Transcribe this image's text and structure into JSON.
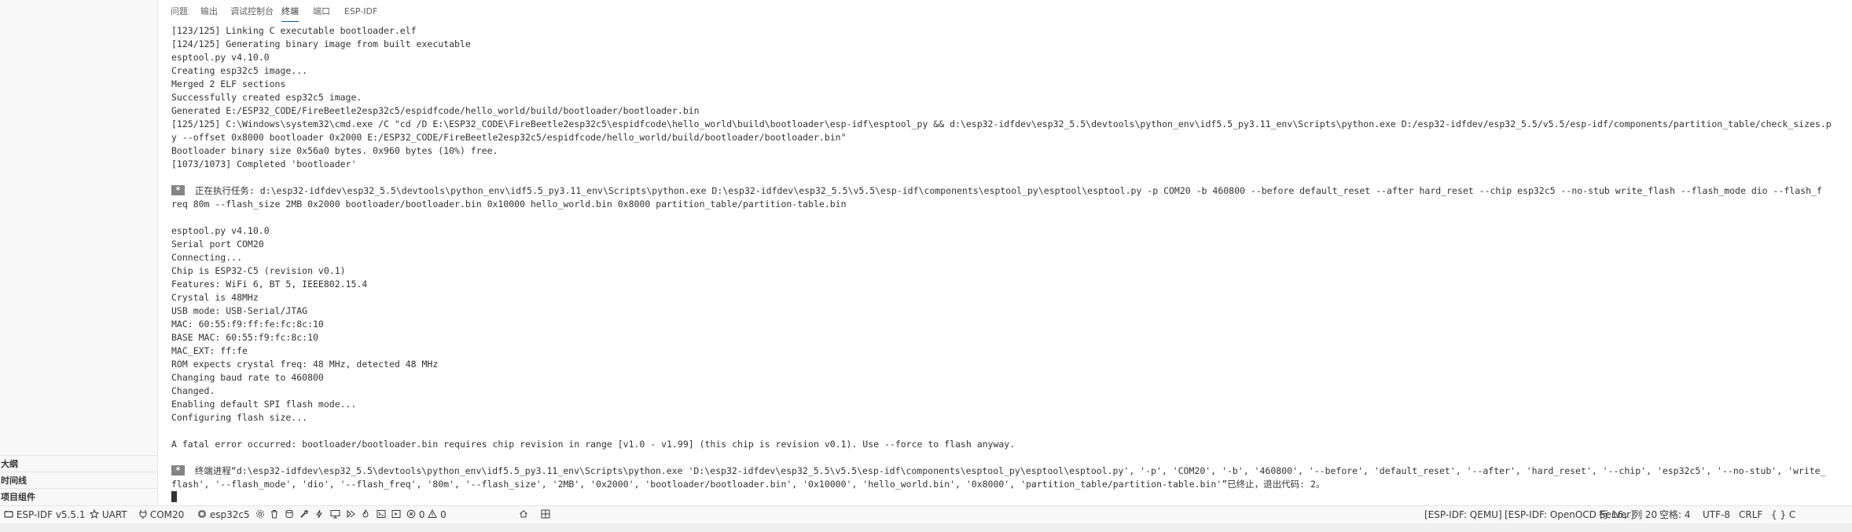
{
  "sidebar": {
    "sections": [
      "大纲",
      "时间线",
      "项目组件"
    ]
  },
  "panel": {
    "tabs": [
      "问题",
      "输出",
      "调试控制台",
      "终端",
      "端口",
      "ESP-IDF"
    ],
    "active_tab": "终端"
  },
  "terminal": {
    "lines": [
      "[123/125] Linking C executable bootloader.elf",
      "[124/125] Generating binary image from built executable",
      "esptool.py v4.10.0",
      "Creating esp32c5 image...",
      "Merged 2 ELF sections",
      "Successfully created esp32c5 image.",
      "Generated E:/ESP32_CODE/FireBeetle2esp32c5/espidfcode/hello_world/build/bootloader/bootloader.bin",
      "[125/125] C:\\Windows\\system32\\cmd.exe /C \"cd /D E:\\ESP32_CODE\\FireBeetle2esp32c5\\espidfcode\\hello_world\\build\\bootloader\\esp-idf\\esptool_py && d:\\esp32-idfdev\\esp32_5.5\\devtools\\python_env\\idf5.5_py3.11_env\\Scripts\\python.exe D:/esp32-idfdev/esp32_5.5/v5.5/esp-idf/components/partition_table/check_sizes.p",
      "y --offset 0x8000 bootloader 0x2000 E:/ESP32_CODE/FireBeetle2esp32c5/espidfcode/hello_world/build/bootloader/bootloader.bin\"",
      "Bootloader binary size 0x56a0 bytes. 0x960 bytes (10%) free.",
      "[1073/1073] Completed 'bootloader'",
      "",
      " 正在执行任务: d:\\esp32-idfdev\\esp32_5.5\\devtools\\python_env\\idf5.5_py3.11_env\\Scripts\\python.exe D:\\esp32-idfdev\\esp32_5.5\\v5.5\\esp-idf\\components\\esptool_py\\esptool\\esptool.py -p COM20 -b 460800 --before default_reset --after hard_reset --chip esp32c5 --no-stub write_flash --flash_mode dio --flash_f",
      "req 80m --flash_size 2MB 0x2000 bootloader/bootloader.bin 0x10000 hello_world.bin 0x8000 partition_table/partition-table.bin",
      "",
      "esptool.py v4.10.0",
      "Serial port COM20",
      "Connecting...",
      "Chip is ESP32-C5 (revision v0.1)",
      "Features: WiFi 6, BT 5, IEEE802.15.4",
      "Crystal is 48MHz",
      "USB mode: USB-Serial/JTAG",
      "MAC: 60:55:f9:ff:fe:fc:8c:10",
      "BASE MAC: 60:55:f9:fc:8c:10",
      "MAC_EXT: ff:fe",
      "ROM expects crystal freq: 48 MHz, detected 48 MHz",
      "Changing baud rate to 460800",
      "Changed.",
      "Enabling default SPI flash mode...",
      "Configuring flash size...",
      "",
      "A fatal error occurred: bootloader/bootloader.bin requires chip revision in range [v1.0 - v1.99] (this chip is revision v0.1). Use --force to flash anyway.",
      "",
      " 终端进程“d:\\esp32-idfdev\\esp32_5.5\\devtools\\python_env\\idf5.5_py3.11_env\\Scripts\\python.exe 'D:\\esp32-idfdev\\esp32_5.5\\v5.5\\esp-idf\\components\\esptool_py\\esptool\\esptool.py', '-p', 'COM20', '-b', '460800', '--before', 'default_reset', '--after', 'hard_reset', '--chip', 'esp32c5', '--no-stub', 'write_",
      "flash', '--flash_mode', 'dio', '--flash_freq', '80m', '--flash_size', '2MB', '0x2000', 'bootloader/bootloader.bin', '0x10000', 'hello_world.bin', '0x8000', 'partition_table/partition-table.bin'”已终止，退出代码: 2。",
      ""
    ],
    "task_star": "*"
  },
  "statusbar": {
    "idf_version": "ESP-IDF v5.5.1",
    "uart": "UART",
    "port": "COM20",
    "target": "esp32c5",
    "problems_errors": "0",
    "problems_warnings": "0",
    "qemu": "[ESP-IDF: QEMU]",
    "openocd": "[ESP-IDF: OpenOCD Server]",
    "cursor_pos": "行 16，列 20",
    "spaces": "空格: 4",
    "encoding": "UTF-8",
    "eol": "CRLF",
    "language": "C",
    "language_braces": "{ }"
  },
  "colors": {
    "accent": "#005fb8",
    "terminal_text": "#333333",
    "statusbar_bg": "#f8f8f8"
  }
}
